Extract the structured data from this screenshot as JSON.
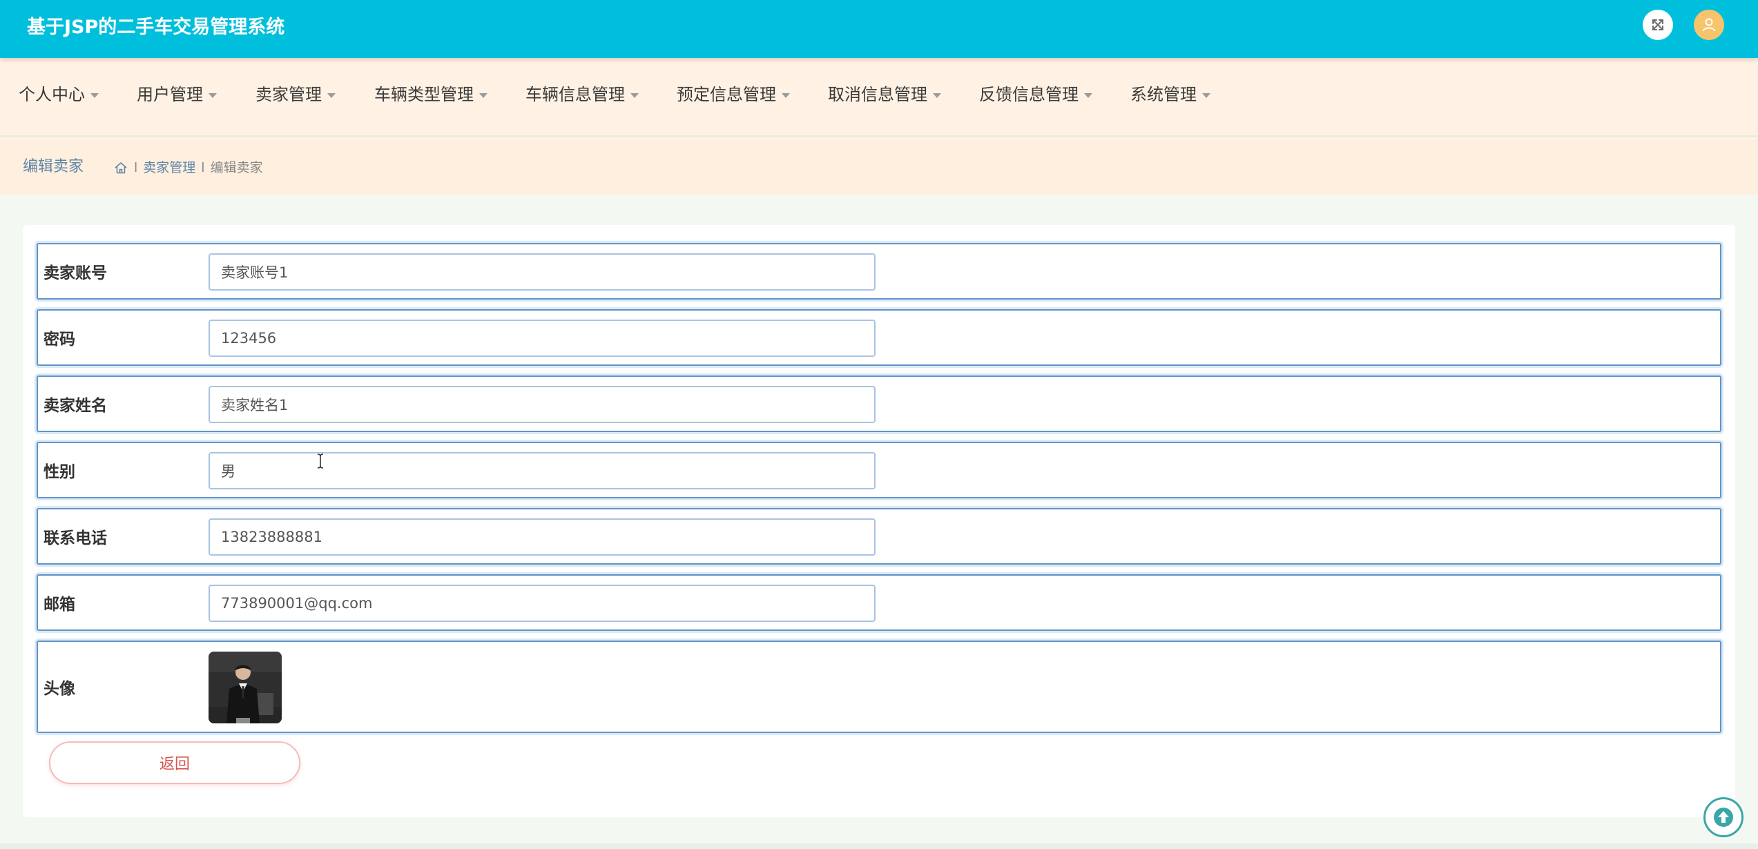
{
  "app": {
    "title": "基于JSP的二手车交易管理系统"
  },
  "topbar": {
    "expand_icon": "fullscreen-icon",
    "user_icon": "user-icon"
  },
  "nav": {
    "items": [
      {
        "label": "个人中心"
      },
      {
        "label": "用户管理"
      },
      {
        "label": "卖家管理"
      },
      {
        "label": "车辆类型管理"
      },
      {
        "label": "车辆信息管理"
      },
      {
        "label": "预定信息管理"
      },
      {
        "label": "取消信息管理"
      },
      {
        "label": "反馈信息管理"
      },
      {
        "label": "系统管理"
      }
    ]
  },
  "breadcrumb": {
    "page_title": "编辑卖家",
    "home_icon": "home-icon",
    "sep": "l",
    "section": "卖家管理",
    "current": "编辑卖家"
  },
  "form": {
    "account": {
      "label": "卖家账号",
      "value": "卖家账号1"
    },
    "password": {
      "label": "密码",
      "value": "123456"
    },
    "name": {
      "label": "卖家姓名",
      "value": "卖家姓名1"
    },
    "gender": {
      "label": "性别",
      "value": "男"
    },
    "phone": {
      "label": "联系电话",
      "value": "13823888881"
    },
    "email": {
      "label": "邮箱",
      "value": "773890001@qq.com"
    },
    "avatar": {
      "label": "头像"
    },
    "back_label": "返回"
  },
  "colors": {
    "topbar": "#00bfdc",
    "nav_bg": "#fff2e4",
    "row_border": "#5f95c8",
    "back_text": "#d9534f"
  }
}
